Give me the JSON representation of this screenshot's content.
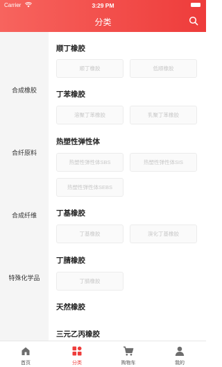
{
  "status_bar": {
    "carrier": "Carrier",
    "time": "3:29 PM"
  },
  "header": {
    "title": "分类"
  },
  "sidebar": {
    "items": [
      {
        "label": "合成橡胶"
      },
      {
        "label": "合纤原料"
      },
      {
        "label": "合成纤维"
      },
      {
        "label": "特殊化学品"
      }
    ]
  },
  "sections": [
    {
      "title": "顺丁橡胶",
      "chips": [
        "顺丁橡胶",
        "低顺橡胶"
      ]
    },
    {
      "title": "丁苯橡胶",
      "chips": [
        "溶聚丁苯橡胶",
        "乳聚丁苯橡胶"
      ]
    },
    {
      "title": "热塑性弹性体",
      "chips": [
        "热塑性弹性体SBS",
        "热塑性弹性体SIS",
        "热塑性弹性体SEBS"
      ]
    },
    {
      "title": "丁基橡胶",
      "chips": [
        "丁基橡胶",
        "溴化丁基橡胶"
      ]
    },
    {
      "title": "丁腈橡胶",
      "chips": [
        "丁腈橡胶"
      ]
    },
    {
      "title": "天然橡胶",
      "chips": []
    },
    {
      "title": "三元乙丙橡胶",
      "chips": []
    }
  ],
  "tabbar": {
    "items": [
      {
        "label": "首页",
        "icon": "home-icon"
      },
      {
        "label": "分类",
        "icon": "category-icon"
      },
      {
        "label": "购物车",
        "icon": "cart-icon"
      },
      {
        "label": "我的",
        "icon": "user-icon"
      }
    ],
    "active_index": 1,
    "active_color": "#ee3c3b",
    "inactive_color": "#555555"
  },
  "colors": {
    "header_start": "#f7645e",
    "header_end": "#ee3c3b",
    "sidebar_bg": "#f5f5f5"
  }
}
